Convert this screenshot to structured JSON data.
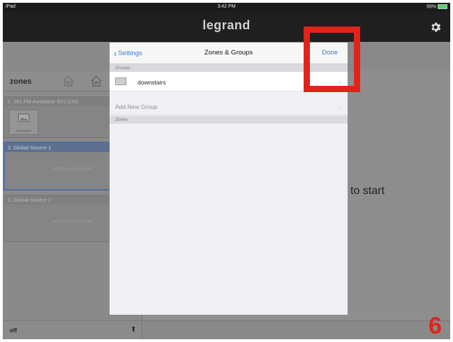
{
  "status_bar": {
    "carrier": "iPad",
    "time": "3:42 PM",
    "battery": "99%"
  },
  "header": {
    "title": "legrand",
    "settings_icon": "gear-icon"
  },
  "sidebar": {
    "title": "zones",
    "sources": [
      {
        "label": "1. 181.FM Awesome 80's (US)",
        "tile_caption": "downstairs"
      },
      {
        "label": "2. Global Source 1",
        "hint": "add a zone to start"
      },
      {
        "label": "3. Global Source 2",
        "hint": "add a zone to start"
      }
    ],
    "bottom_label": "off"
  },
  "main": {
    "hint": "to start"
  },
  "modal": {
    "back_label": "Settings",
    "title": "Zones & Groups",
    "done_label": "Done",
    "groups_header": "Groups",
    "groups": [
      {
        "name": "downstairs"
      }
    ],
    "add_group_label": "Add New Group",
    "zones_header": "Zones"
  },
  "annotation": {
    "step_number": "6",
    "highlight_color": "#e2231a"
  },
  "colors": {
    "accent": "#3478d4",
    "title_bar": "#1f1f1f",
    "selected_source": "#5d7090"
  }
}
